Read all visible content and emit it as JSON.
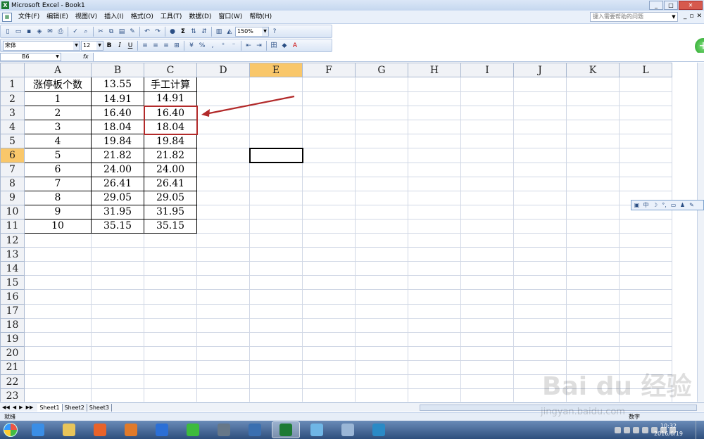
{
  "window": {
    "title": "Microsoft Excel - Book1",
    "app_icon": "X",
    "buttons": [
      "_",
      "□",
      "✕"
    ]
  },
  "menubar": {
    "items": [
      "文件(F)",
      "编辑(E)",
      "视图(V)",
      "插入(I)",
      "格式(O)",
      "工具(T)",
      "数据(D)",
      "窗口(W)",
      "帮助(H)"
    ],
    "help_placeholder": "键入需要帮助的问题",
    "mdi_buttons": [
      "_",
      "▫",
      "✕"
    ]
  },
  "toolbar": {
    "zoom": "150%",
    "font_name": "宋体",
    "font_size": "12",
    "bold": "B",
    "italic": "I",
    "underline": "U",
    "sigma": "Σ",
    "percent": "%",
    "currency_grid": "田"
  },
  "formula_bar": {
    "name_box": "B6",
    "fx": "fx",
    "formula": ""
  },
  "columns": [
    "A",
    "B",
    "C",
    "D",
    "E",
    "F",
    "G",
    "H",
    "I",
    "J",
    "K",
    "L"
  ],
  "selected_column": "E",
  "selected_row": "6",
  "rows": [
    {
      "n": "1",
      "A": "涨停板个数",
      "B": "13.55",
      "C": "手工计算"
    },
    {
      "n": "2",
      "A": "1",
      "B": "14.91",
      "C": "14.91"
    },
    {
      "n": "3",
      "A": "2",
      "B": "16.40",
      "C": "16.40"
    },
    {
      "n": "4",
      "A": "3",
      "B": "18.04",
      "C": "18.04"
    },
    {
      "n": "5",
      "A": "4",
      "B": "19.84",
      "C": "19.84"
    },
    {
      "n": "6",
      "A": "5",
      "B": "21.82",
      "C": "21.82"
    },
    {
      "n": "7",
      "A": "6",
      "B": "24.00",
      "C": "24.00"
    },
    {
      "n": "8",
      "A": "7",
      "B": "26.41",
      "C": "26.41"
    },
    {
      "n": "9",
      "A": "8",
      "B": "29.05",
      "C": "29.05"
    },
    {
      "n": "10",
      "A": "9",
      "B": "31.95",
      "C": "31.95"
    },
    {
      "n": "11",
      "A": "10",
      "B": "35.15",
      "C": "35.15"
    },
    {
      "n": "12"
    },
    {
      "n": "13"
    },
    {
      "n": "14"
    },
    {
      "n": "15"
    },
    {
      "n": "16"
    },
    {
      "n": "17"
    },
    {
      "n": "18"
    },
    {
      "n": "19"
    },
    {
      "n": "20"
    },
    {
      "n": "21"
    },
    {
      "n": "22"
    },
    {
      "n": "23"
    }
  ],
  "sheet_tabs": [
    "Sheet1",
    "Sheet2",
    "Sheet3"
  ],
  "active_sheet": "Sheet1",
  "status": {
    "left": "就绪",
    "right": "数字"
  },
  "ime_bar": [
    "中",
    "☽",
    "°,",
    "▭",
    "♟",
    "✎"
  ],
  "taskbar": {
    "clock_time": "10:32",
    "clock_date": "2016/6/19",
    "apps": [
      {
        "name": "ie-icon",
        "color": "#3a8ee6"
      },
      {
        "name": "folder-icon",
        "color": "#e8c55a"
      },
      {
        "name": "browser-icon",
        "color": "#e8632a"
      },
      {
        "name": "media-player-icon",
        "color": "#e07a2a"
      },
      {
        "name": "qq-icon",
        "color": "#2b6fd6"
      },
      {
        "name": "360-icon",
        "color": "#3dbb3d"
      },
      {
        "name": "film-icon",
        "color": "#667788"
      },
      {
        "name": "video-icon",
        "color": "#3a6fb0"
      },
      {
        "name": "excel-icon",
        "color": "#1d7a35",
        "active": true
      },
      {
        "name": "notepad-icon",
        "color": "#6fb6e6"
      },
      {
        "name": "paint-icon",
        "color": "#9ab6d6"
      },
      {
        "name": "network-icon",
        "color": "#2a8ac6"
      }
    ]
  },
  "watermark": {
    "text": "Bai du 经验",
    "sub": "jingyan.baidu.com"
  },
  "colors": {
    "highlight": "#b22a2a",
    "selected_header": "#f9c76a",
    "grid": "#d0d7e5"
  }
}
